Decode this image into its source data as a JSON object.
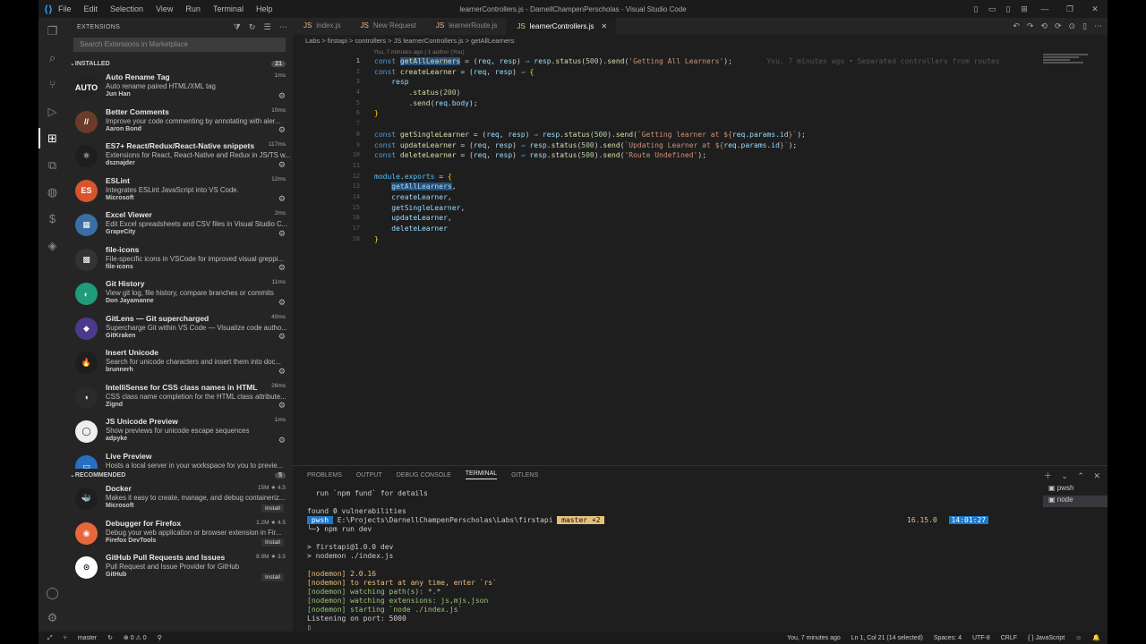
{
  "window": {
    "title": "learnerControllers.js - DarnellChampenPerscholas - Visual Studio Code",
    "menu": [
      "File",
      "Edit",
      "Selection",
      "View",
      "Run",
      "Terminal",
      "Help"
    ]
  },
  "sidebar": {
    "header": "EXTENSIONS",
    "search_placeholder": "Search Extensions in Marketplace",
    "installed_label": "INSTALLED",
    "installed_count": "21",
    "recommended_label": "RECOMMENDED",
    "recommended_count": "5",
    "installed": [
      {
        "name": "Auto Rename Tag",
        "desc": "Auto rename paired HTML/XML tag",
        "pub": "Jun Han",
        "meta": "1ms",
        "icon": "AUTO",
        "color": "#222"
      },
      {
        "name": "Better Comments",
        "desc": "Improve your code commenting by annotating with aler...",
        "pub": "Aaron Bond",
        "meta": "10ms",
        "icon": "//",
        "color": "#6b3b2a"
      },
      {
        "name": "ES7+ React/Redux/React-Native snippets",
        "desc": "Extensions for React, React-Native and Redux in JS/TS w...",
        "pub": "dsznajder",
        "meta": "117ms",
        "icon": "⚛",
        "color": "#1e1e1e"
      },
      {
        "name": "ESLint",
        "desc": "Integrates ESLint JavaScript into VS Code.",
        "pub": "Microsoft",
        "meta": "12ms",
        "icon": "ES",
        "color": "#d9542c"
      },
      {
        "name": "Excel Viewer",
        "desc": "Edit Excel spreadsheets and CSV files in Visual Studio C...",
        "pub": "GrapeCity",
        "meta": "2ms",
        "icon": "▦",
        "color": "#3a6ea5"
      },
      {
        "name": "file-icons",
        "desc": "File-specific icons in VSCode for improved visual greppi...",
        "pub": "file-icons",
        "meta": "",
        "icon": "▩",
        "color": "#333"
      },
      {
        "name": "Git History",
        "desc": "View git log, file history, compare branches or commits",
        "pub": "Don Jayamanne",
        "meta": "11ms",
        "icon": "◐",
        "color": "#1f9c7a"
      },
      {
        "name": "GitLens — Git supercharged",
        "desc": "Supercharge Git within VS Code — Visualize code autho...",
        "pub": "GitKraken",
        "meta": "40ms",
        "icon": "◆",
        "color": "#4b3a8c"
      },
      {
        "name": "Insert Unicode",
        "desc": "Search for unicode characters and insert them into doc...",
        "pub": "brunnerh",
        "meta": "",
        "icon": "🔥",
        "color": "#1e1e1e"
      },
      {
        "name": "IntelliSense for CSS class names in HTML",
        "desc": "CSS class name completion for the HTML class attribute...",
        "pub": "Zignd",
        "meta": "26ms",
        "icon": "◖",
        "color": "#2a2a2a"
      },
      {
        "name": "JS Unicode Preview",
        "desc": "Show previews for unicode escape sequences",
        "pub": "adpyke",
        "meta": "1ms",
        "icon": "◯",
        "color": "#eee"
      },
      {
        "name": "Live Preview",
        "desc": "Hosts a local server in your workspace for you to previe...",
        "pub": "",
        "meta": "",
        "icon": "▭",
        "color": "#2670c4"
      }
    ],
    "recommended": [
      {
        "name": "Docker",
        "desc": "Makes it easy to create, manage, and debug containeriz...",
        "pub": "Microsoft",
        "meta": "15M ★ 4.5",
        "icon": "🐳",
        "color": "#1e1e1e",
        "btn": "Install"
      },
      {
        "name": "Debugger for Firefox",
        "desc": "Debug your web application or browser extension in Fir...",
        "pub": "Firefox DevTools",
        "meta": "1.2M ★ 4.5",
        "icon": "◉",
        "color": "#e6673c",
        "btn": "Install"
      },
      {
        "name": "GitHub Pull Requests and Issues",
        "desc": "Pull Request and Issue Provider for GitHub",
        "pub": "GitHub",
        "meta": "8.9M ★ 3.5",
        "icon": "⊙",
        "color": "#fff",
        "btn": "Install"
      }
    ]
  },
  "editor": {
    "tabs": [
      {
        "label": "index.js",
        "active": false
      },
      {
        "label": "New Request",
        "active": false
      },
      {
        "label": "learnerRoute.js",
        "active": false
      },
      {
        "label": "learnerControllers.js",
        "active": true
      }
    ],
    "breadcrumb": "Labs > firstapi > controllers > JS learnerControllers.js > getAllLearners",
    "blame_hint": "You, 7 minutes ago | 1 author (You)",
    "line_numbers": [
      "1",
      "2",
      "3",
      "4",
      "5",
      "6",
      "7",
      "8",
      "9",
      "10",
      "11",
      "12",
      "13",
      "14",
      "15",
      "16",
      "17",
      "18"
    ],
    "ghost_blame": "You, 7 minutes ago • Separated controllers from routes"
  },
  "panel": {
    "tabs": [
      "PROBLEMS",
      "OUTPUT",
      "DEBUG CONSOLE",
      "TERMINAL",
      "GITLENS"
    ],
    "active_tab": "TERMINAL",
    "terminal_lines": [
      "  run `npm fund` for details",
      "",
      "found 0 vulnerabilities",
      "",
      "",
      "",
      "> firstapi@1.0.0 dev",
      "> nodemon ./index.js",
      "",
      "[nodemon] 2.0.16",
      "[nodemon] to restart at any time, enter `rs`",
      "[nodemon] watching path(s): *.*",
      "[nodemon] watching extensions: js,mjs,json",
      "[nodemon] starting `node ./index.js`",
      "Listening on port: 5000"
    ],
    "prompt_shell": "pwsh",
    "prompt_path": "E:\\Projects\\DarnellChampenPerscholas\\Labs\\firstapi",
    "prompt_branch": " master +2 ",
    "prompt_cmd": "npm run dev",
    "node_version": "16.15.0",
    "clock": "14:01:27",
    "terminals": [
      "pwsh",
      "node"
    ]
  },
  "statusbar": {
    "branch": "master",
    "problems": "⊗ 0 ⚠ 0",
    "blame": "You, 7 minutes ago",
    "position": "Ln 1, Col 21 (14 selected)",
    "spaces": "Spaces: 4",
    "encoding": "UTF-8",
    "eol": "CRLF",
    "language": "{ } JavaScript"
  }
}
